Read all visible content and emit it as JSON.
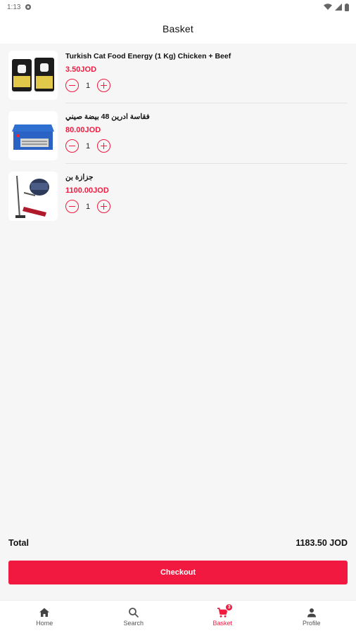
{
  "status_bar": {
    "time": "1:13"
  },
  "app_bar": {
    "title": "Basket"
  },
  "items": [
    {
      "title": "Turkish Cat Food Energy (1 Kg) Chicken + Beef",
      "price": "3.50JOD",
      "quantity": "1",
      "image": "cat-food-bags"
    },
    {
      "title": "فقاسة ادرين 48 بيضة صيني",
      "price": "80.00JOD",
      "quantity": "1",
      "image": "egg-incubator"
    },
    {
      "title": "جزازة بن",
      "price": "1100.00JOD",
      "quantity": "1",
      "image": "grass-trimmer"
    }
  ],
  "summary": {
    "total_label": "Total",
    "total_value": "1183.50 JOD",
    "checkout_label": "Checkout"
  },
  "nav": {
    "items": [
      {
        "label": "Home",
        "icon": "home-icon"
      },
      {
        "label": "Search",
        "icon": "search-icon"
      },
      {
        "label": "Basket",
        "icon": "cart-icon",
        "badge": "3"
      },
      {
        "label": "Profile",
        "icon": "profile-icon"
      }
    ]
  },
  "colors": {
    "accent": "#f1193f",
    "background": "#f6f6f6"
  }
}
